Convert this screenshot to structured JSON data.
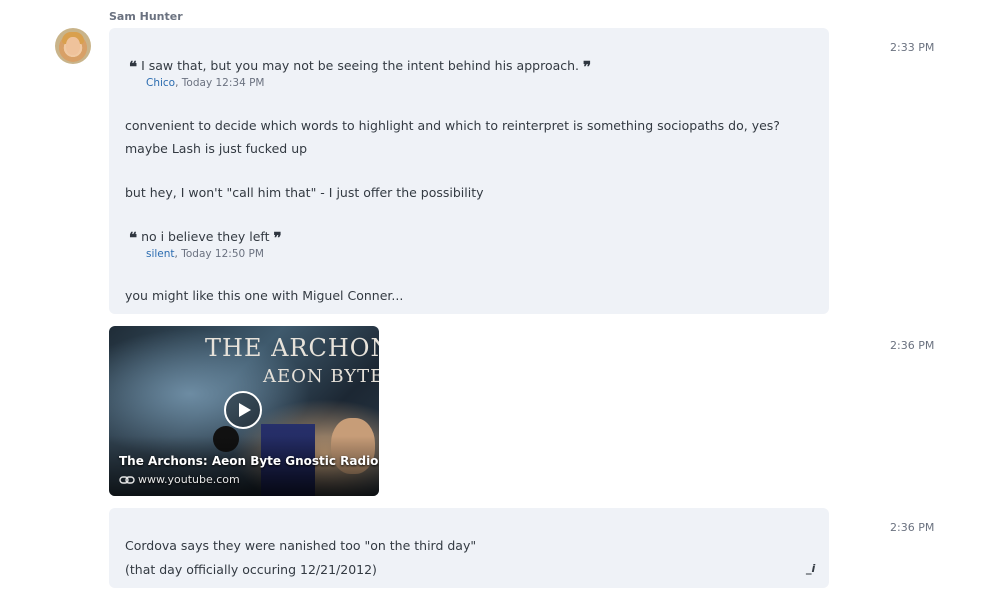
{
  "sender": {
    "name": "Sam Hunter"
  },
  "messages": [
    {
      "time": "2:33 PM",
      "quote1": {
        "text": "I saw that, but you may not be seeing the intent behind his approach.",
        "author": "Chico",
        "when": ", Today 12:34 PM"
      },
      "lines": [
        "convenient to decide which words to highlight and which to reinterpret is something sociopaths do, yes?",
        "maybe Lash is just fucked up",
        "but hey, I won't \"call him that\" - I just offer the possibility"
      ],
      "quote2": {
        "text": "no i believe they left",
        "author": "silent",
        "when": ", Today 12:50 PM"
      },
      "closing": "you might like this one with Miguel Conner..."
    },
    {
      "time": "2:36 PM",
      "video": {
        "title": "The Archons: Aeon Byte Gnostic Radio...",
        "domain": "www.youtube.com",
        "thumb_text_1": "THE ARCHONS",
        "thumb_text_2": "AEON BYTE"
      }
    },
    {
      "time": "2:36 PM",
      "lines": [
        "Cordova says they were nanished too \"on the third day\"",
        "(that day officially occuring 12/21/2012)"
      ]
    }
  ],
  "icons": {
    "quote_open": "❝",
    "quote_close": "❞",
    "edit": "_i"
  }
}
